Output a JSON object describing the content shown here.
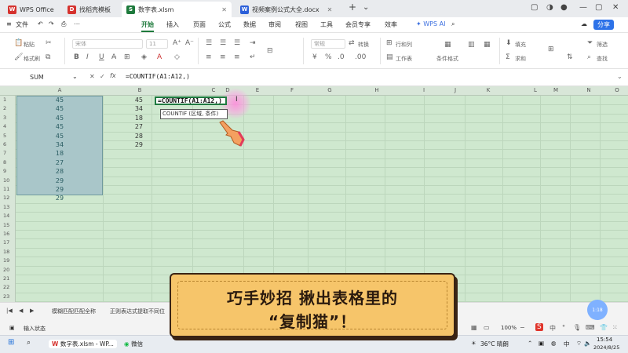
{
  "tabs": [
    {
      "label": "WPS Office",
      "color": "#d5322e",
      "glyph": "W"
    },
    {
      "label": "找稻壳模板",
      "color": "#d5322e",
      "glyph": "D"
    },
    {
      "label": "数字表.xlsm",
      "color": "#1e7a3c",
      "glyph": "S"
    },
    {
      "label": "视频案例公式大全.docx",
      "color": "#2b5fd9",
      "glyph": "W"
    }
  ],
  "menu": {
    "file": "文件",
    "items": [
      "开始",
      "插入",
      "页面",
      "公式",
      "数据",
      "审阅",
      "视图",
      "工具",
      "会员专享",
      "效率"
    ],
    "ai": "WPS AI",
    "share": "分享"
  },
  "ribbon": {
    "paste": "粘贴",
    "format_painter": "格式刷",
    "cut": "剪切",
    "copy": "复制",
    "font_name": "宋体",
    "font_size": "11",
    "number_format": "常规",
    "convert": "转换",
    "row_col": "行和列",
    "worksheet": "工作表",
    "cond_format": "条件格式",
    "fill": "填充",
    "sum": "求和",
    "filter": "筛选",
    "sort": "排序",
    "find": "查找"
  },
  "formula_bar": {
    "name_box": "SUM",
    "fx": "fx",
    "formula": "=COUNTIF(A1:A12,)"
  },
  "columns": [
    "A",
    "B",
    "C",
    "D",
    "E",
    "F",
    "G",
    "H",
    "I",
    "J",
    "K",
    "L",
    "M",
    "N",
    "O"
  ],
  "rows": [
    "1",
    "2",
    "3",
    "4",
    "5",
    "6",
    "7",
    "8",
    "9",
    "10",
    "11",
    "12",
    "13",
    "14",
    "15",
    "16",
    "17",
    "18",
    "19",
    "20",
    "21",
    "22",
    "23"
  ],
  "col_a": [
    "45",
    "45",
    "45",
    "45",
    "45",
    "34",
    "18",
    "27",
    "28",
    "29",
    "29",
    "29"
  ],
  "col_b": [
    "45",
    "34",
    "18",
    "27",
    "28",
    "29"
  ],
  "active_cell": "=COUNTIF(A1:A12,)",
  "tooltip": "COUNTIF (区域, 条件)",
  "banner": {
    "line1": "巧手妙招 揪出表格里的",
    "line2": "“复制猫”！"
  },
  "sheet_tabs": [
    "模糊匹配匹配全称",
    "正则表达式提取不同位"
  ],
  "status": {
    "input_mode": "输入状态",
    "zoom": "100%"
  },
  "taskbar": {
    "app1": "数字表.xlsm - WP...",
    "app2": "微信",
    "weather": "36°C 晴朗",
    "time": "15:54",
    "date": "2024/8/25"
  },
  "float_button": "1:18"
}
